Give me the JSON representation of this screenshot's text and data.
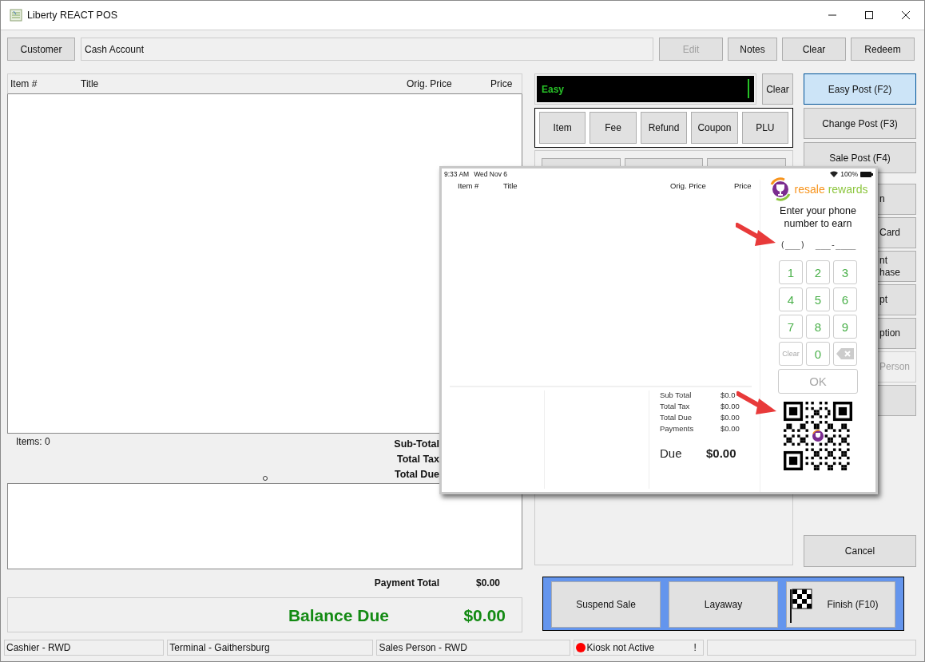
{
  "window": {
    "title": "Liberty REACT POS"
  },
  "customer_bar": {
    "button": "Customer",
    "account": "Cash Account",
    "buttons": [
      {
        "label": "Edit",
        "disabled": true
      },
      {
        "label": "Notes",
        "disabled": false
      },
      {
        "label": "Clear",
        "disabled": false
      },
      {
        "label": "Redeem",
        "disabled": false
      }
    ]
  },
  "items_table": {
    "columns": [
      "Item #",
      "Title",
      "Orig. Price",
      "Price"
    ]
  },
  "summary": {
    "items_count": "Items: 0",
    "totals": [
      "Sub-Total",
      "Total Tax",
      "Total Due"
    ]
  },
  "payment_total": {
    "label": "Payment Total",
    "value": "$0.00"
  },
  "balance_due": {
    "label": "Balance Due",
    "value": "$0.00"
  },
  "entry": {
    "value": "Easy",
    "clear": "Clear"
  },
  "entry_types": [
    "Item",
    "Fee",
    "Refund",
    "Coupon",
    "PLU"
  ],
  "post_modes": [
    {
      "label": "Easy Post (F2)",
      "selected": true
    },
    {
      "label": "Change Post (F3)",
      "selected": false
    },
    {
      "label": "Sale Post (F4)",
      "selected": false
    }
  ],
  "side_buttons": [
    {
      "lines": [
        "n"
      ],
      "disabled": false
    },
    {
      "lines": [
        "Card"
      ],
      "disabled": false
    },
    {
      "lines": [
        "nt",
        "hase"
      ],
      "disabled": false
    },
    {
      "lines": [
        "pt"
      ],
      "disabled": false
    },
    {
      "lines": [
        "ption"
      ],
      "disabled": false
    },
    {
      "lines": [
        "Person"
      ],
      "disabled": true
    },
    {
      "disabled": false
    }
  ],
  "cancel": "Cancel",
  "actions": [
    {
      "label": "Suspend Sale",
      "kind": "plain"
    },
    {
      "label": "Layaway",
      "kind": "plain"
    },
    {
      "label": "Finish (F10)",
      "kind": "flag"
    }
  ],
  "status_bar": [
    {
      "kind": "text",
      "text": "Cashier - RWD"
    },
    {
      "kind": "text",
      "text": "Terminal - Gaithersburg"
    },
    {
      "kind": "text",
      "text": "Sales Person - RWD"
    },
    {
      "kind": "indicator",
      "text": "Kiosk not Active",
      "color": "#ff0000",
      "flag": "!"
    },
    {
      "kind": "empty"
    }
  ],
  "kiosk_preview": {
    "time": "9:33 AM",
    "date": "Wed Nov 6",
    "battery": "100%",
    "columns": [
      "Item #",
      "Title",
      "Orig. Price",
      "Price"
    ],
    "brand": {
      "first": "resale",
      "second": "rewards"
    },
    "prompt": "Enter your phone number to earn",
    "phone_mask": "(___)  ___-____",
    "keys": [
      {
        "kind": "digit",
        "label": "1"
      },
      {
        "kind": "digit",
        "label": "2"
      },
      {
        "kind": "digit",
        "label": "3"
      },
      {
        "kind": "digit",
        "label": "4"
      },
      {
        "kind": "digit",
        "label": "5"
      },
      {
        "kind": "digit",
        "label": "6"
      },
      {
        "kind": "digit",
        "label": "7"
      },
      {
        "kind": "digit",
        "label": "8"
      },
      {
        "kind": "digit",
        "label": "9"
      },
      {
        "kind": "clear",
        "label": "Clear",
        "disabled": true
      },
      {
        "kind": "digit",
        "label": "0"
      },
      {
        "kind": "backspace"
      }
    ],
    "ok": {
      "label": "OK",
      "disabled": true
    },
    "totals": [
      {
        "label": "Sub Total",
        "value": "$0.0"
      },
      {
        "label": "Total Tax",
        "value": "$0.00"
      },
      {
        "label": "Total Due",
        "value": "$0.00"
      },
      {
        "label": "Payments",
        "value": "$0.00"
      }
    ],
    "due": {
      "label": "Due",
      "value": "$0.00"
    }
  }
}
